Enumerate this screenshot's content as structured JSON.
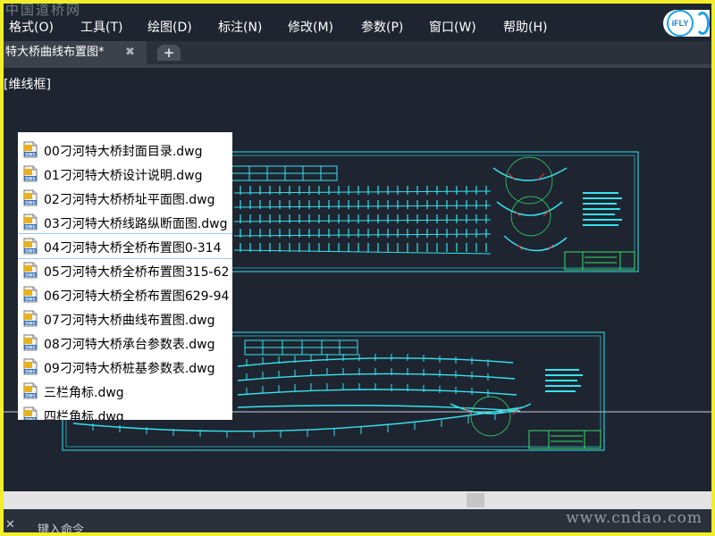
{
  "watermark_top": "中国道桥网",
  "watermark_bottom": "www.cndao.com",
  "menu": [
    "格式(O)",
    "工具(T)",
    "绘图(D)",
    "标注(N)",
    "修改(M)",
    "参数(P)",
    "窗口(W)",
    "帮助(H)"
  ],
  "logo_text": "iFLY",
  "tab": {
    "title": "特大桥曲线布置图*",
    "close": "✖",
    "add": "+"
  },
  "viewport_label": "[维线框]",
  "files": [
    "00刁河特大桥封面目录.dwg",
    "01刁河特大桥设计说明.dwg",
    "02刁河特大桥桥址平面图.dwg",
    "03刁河特大桥线路纵断面图.dwg",
    "04刁河特大桥全桥布置图0-314",
    "05刁河特大桥全桥布置图315-62",
    "06刁河特大桥全桥布置图629-94",
    "07刁河特大桥曲线布置图.dwg",
    "08刁河特大桥承台参数表.dwg",
    "09刁河特大桥桩基参数表.dwg",
    "三栏角标.dwg",
    "四栏角标.dwg"
  ],
  "selected_index": 4,
  "command": {
    "prompt": "键入命令",
    "close": "✕"
  },
  "colors": {
    "background": "#1e2530",
    "cad_cyan": "#36e2ee",
    "cad_green": "#36e06a",
    "cad_red": "#e23636",
    "frame_yellow": "#f2ee2a"
  }
}
